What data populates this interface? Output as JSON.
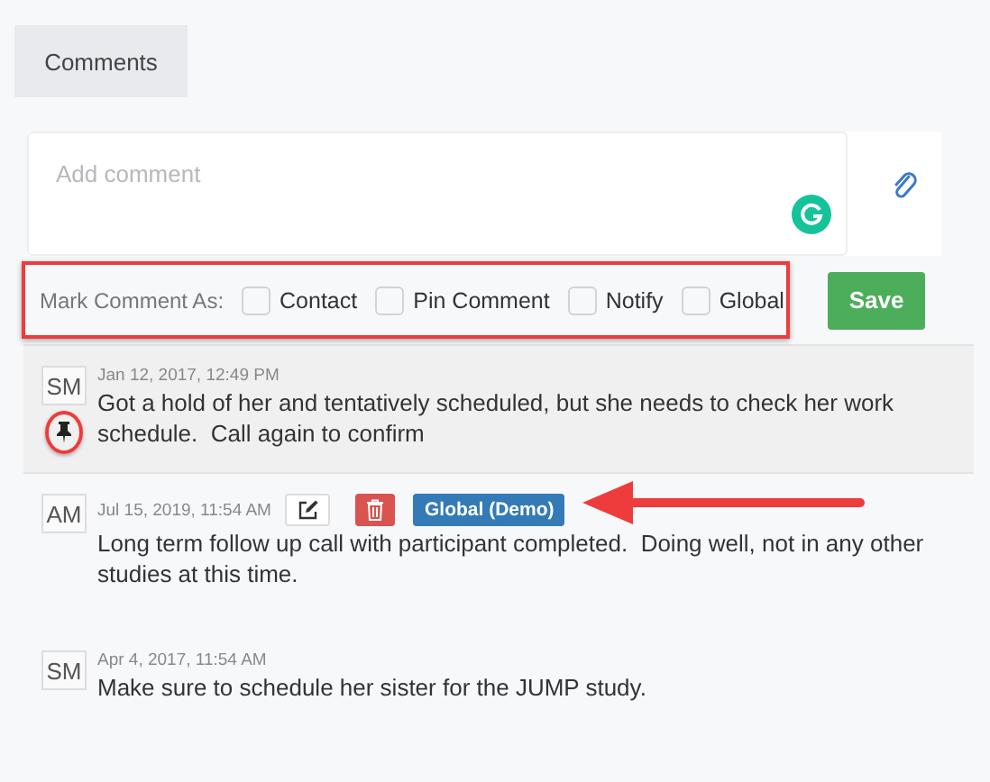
{
  "tab": {
    "label": "Comments",
    "selected": true
  },
  "editor": {
    "placeholder": "Add comment"
  },
  "mark_options": {
    "label": "Mark Comment As:",
    "options": [
      {
        "label": "Contact",
        "checked": false
      },
      {
        "label": "Pin Comment",
        "checked": false
      },
      {
        "label": "Notify",
        "checked": false
      },
      {
        "label": "Global",
        "checked": false
      }
    ]
  },
  "save_button": "Save",
  "comments": [
    {
      "initials": "SM",
      "date": "Jan 12, 2017, 12:49 PM",
      "text": "Got a hold of her and tentatively scheduled, but she needs to check her work schedule.  Call again to confirm",
      "pinned": true,
      "editable": false
    },
    {
      "initials": "AM",
      "date": "Jul 15, 2019, 11:54 AM",
      "text": "Long term follow up call with participant completed.  Doing well, not in any other studies at this time.",
      "pinned": false,
      "editable": true,
      "badge": "Global (Demo)"
    },
    {
      "initials": "SM",
      "date": "Apr 4, 2017, 11:54 AM",
      "text": "Make sure to schedule her sister for the JUMP study.",
      "pinned": false,
      "editable": false
    }
  ]
}
